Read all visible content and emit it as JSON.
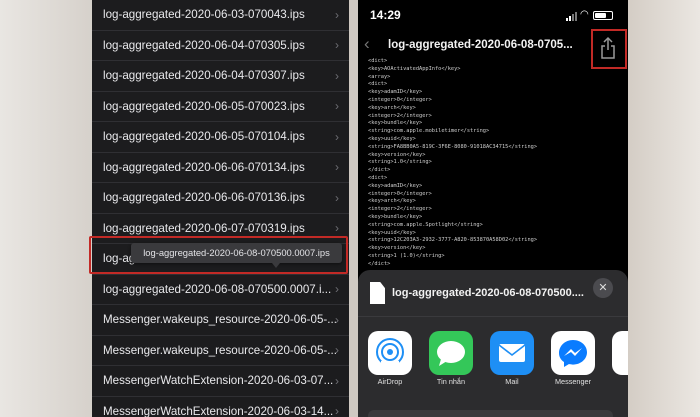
{
  "left": {
    "files": [
      "log-aggregated-2020-06-03-070043.ips",
      "log-aggregated-2020-06-04-070305.ips",
      "log-aggregated-2020-06-04-070307.ips",
      "log-aggregated-2020-06-05-070023.ips",
      "log-aggregated-2020-06-05-070104.ips",
      "log-aggregated-2020-06-06-070134.ips",
      "log-aggregated-2020-06-06-070136.ips",
      "log-aggregated-2020-06-07-070319.ips",
      "log-ag",
      "log-aggregated-2020-06-08-070500.0007.i...",
      "Messenger.wakeups_resource-2020-06-05-...",
      "Messenger.wakeups_resource-2020-06-05-...",
      "MessengerWatchExtension-2020-06-03-07...",
      "MessengerWatchExtension-2020-06-03-14..."
    ],
    "chevron": "›",
    "tooltip": "log-aggregated-2020-06-08-070500.0007.ips"
  },
  "right": {
    "time": "14:29",
    "nav_title": "log-aggregated-2020-06-08-0705...",
    "xml_lines": [
      "<dict>",
      "  <key>AOActivatedAppInfo</key>",
      "  <array>",
      "    <dict>",
      "      <key>adamID</key>",
      "      <integer>0</integer>",
      "      <key>arch</key>",
      "      <integer>2</integer>",
      "      <key>bundle</key>",
      "      <string>com.apple.mobiletimer</string>",
      "      <key>uuid</key>",
      "      <string>FA8BB0A5-819C-3F6E-8080-91018AC34715</string>",
      "      <key>version</key>",
      "      <string>1.0</string>",
      "    </dict>",
      "    <dict>",
      "      <key>adamID</key>",
      "      <integer>0</integer>",
      "      <key>arch</key>",
      "      <integer>2</integer>",
      "      <key>bundle</key>",
      "      <string>com.apple.Spotlight</string>",
      "      <key>uuid</key>",
      "      <string>12C203A3-2932-3777-A820-853870A58D02</string>",
      "      <key>version</key>",
      "      <string>1 (1.0)</string>",
      "    </dict>"
    ],
    "share_sheet": {
      "file_name": "log-aggregated-2020-06-08-070500....",
      "close": "✕",
      "apps": [
        {
          "label": "AirDrop",
          "icon": "airdrop-icon",
          "color": "#ffffff"
        },
        {
          "label": "Tin nhắn",
          "icon": "messages-icon",
          "color": "#34c759"
        },
        {
          "label": "Mail",
          "icon": "mail-icon",
          "color": "#1e8ff5"
        },
        {
          "label": "Messenger",
          "icon": "messenger-icon",
          "color": "#ffffff"
        }
      ]
    }
  },
  "colors": {
    "highlight": "#c22a26",
    "list_bg": "#1c1c1e"
  }
}
